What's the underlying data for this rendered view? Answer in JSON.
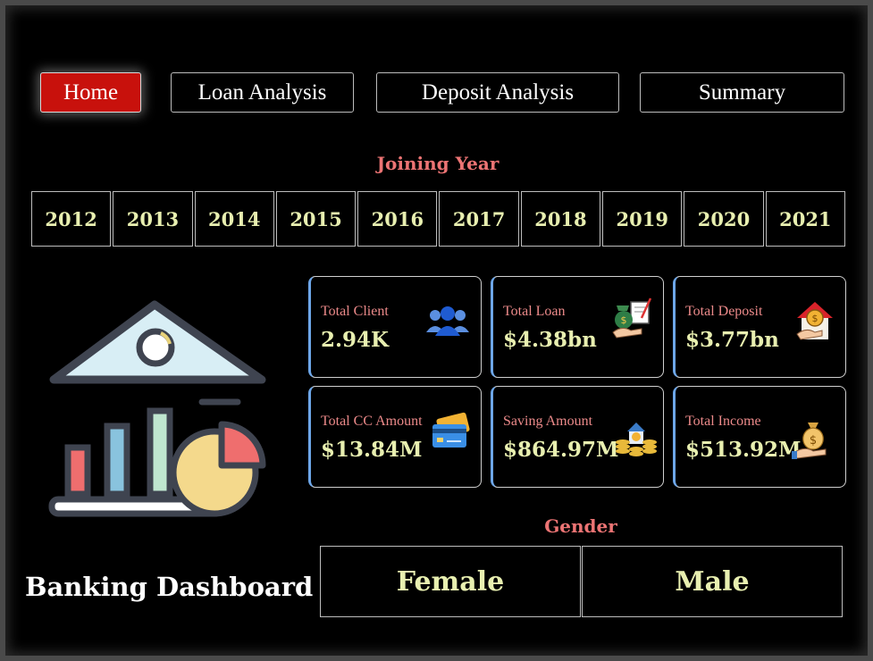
{
  "nav": {
    "home": "Home",
    "loan_analysis": "Loan Analysis",
    "deposit_analysis": "Deposit Analysis",
    "summary": "Summary"
  },
  "joining_year": {
    "label": "Joining Year",
    "years": [
      "2012",
      "2013",
      "2014",
      "2015",
      "2016",
      "2017",
      "2018",
      "2019",
      "2020",
      "2021"
    ]
  },
  "kpis": [
    {
      "label": "Total Client",
      "value": "2.94K",
      "icon": "clients-icon"
    },
    {
      "label": "Total Loan",
      "value": "$4.38bn",
      "icon": "loan-icon"
    },
    {
      "label": "Total Deposit",
      "value": "$3.77bn",
      "icon": "deposit-house-icon"
    },
    {
      "label": "Total CC Amount",
      "value": "$13.84M",
      "icon": "credit-card-icon"
    },
    {
      "label": "Saving Amount",
      "value": "$864.97M",
      "icon": "savings-icon"
    },
    {
      "label": "Total Income",
      "value": "$513.92M",
      "icon": "income-bag-icon"
    }
  ],
  "gender": {
    "label": "Gender",
    "options": [
      "Female",
      "Male"
    ]
  },
  "dashboard_title": "Banking Dashboard",
  "colors": {
    "background": "#000000",
    "active_button": "#c8110c",
    "accent_label": "#ec7474",
    "value_text": "#e8efb0",
    "card_edge": "#6da6e8"
  }
}
